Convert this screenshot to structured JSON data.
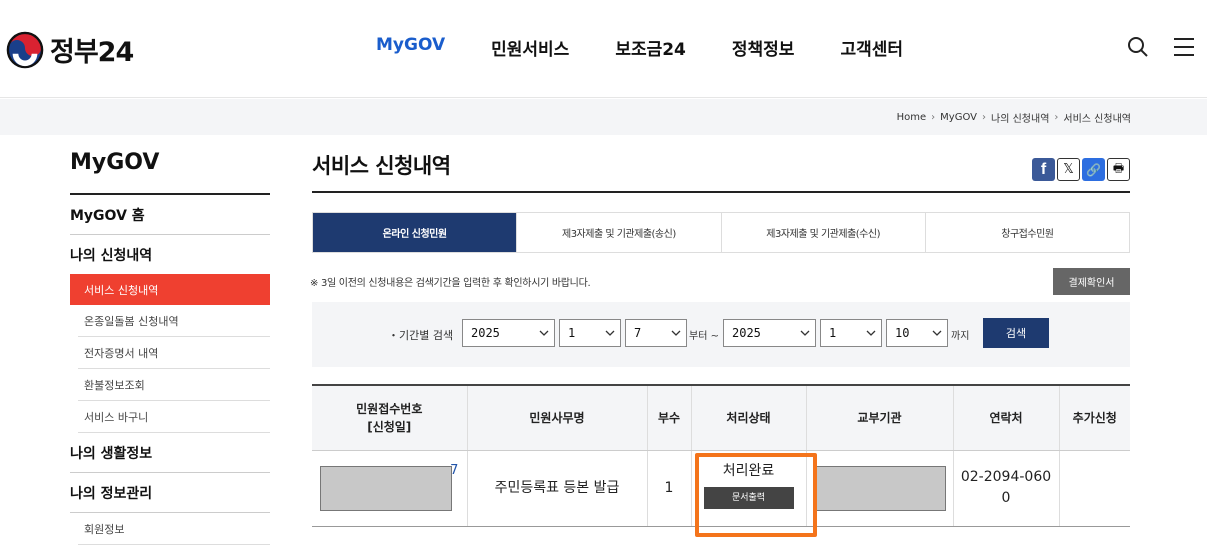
{
  "header": {
    "logo_text": "정부24",
    "nav": [
      "MyGOV",
      "민원서비스",
      "보조금24",
      "정책정보",
      "고객센터"
    ],
    "active_nav": "MyGOV",
    "icons": [
      "search-icon",
      "menu-icon"
    ]
  },
  "breadcrumb": [
    "Home",
    "MyGOV",
    "나의 신청내역",
    "서비스 신청내역"
  ],
  "sidebar": {
    "title": "MyGOV",
    "home": "MyGOV 홈",
    "section1": "나의 신청내역",
    "section1_items": [
      "서비스 신청내역",
      "온종일돌봄 신청내역",
      "전자증명서 내역",
      "환불정보조회",
      "서비스 바구니"
    ],
    "section2": "나의 생활정보",
    "section3": "나의 정보관리",
    "section3_items": [
      "회원정보"
    ]
  },
  "main": {
    "title": "서비스 신청내역",
    "share_icons": [
      "facebook-icon",
      "x-icon",
      "link-icon",
      "print-icon"
    ],
    "tabs": [
      "온라인 신청민원",
      "제3자제출 및 기관제출(송신)",
      "제3자제출 및 기관제출(수신)",
      "창구접수민원"
    ],
    "notice": "※ 3일 이전의 신청내용은 검색기간을 입력한 후 확인하시기 바랍니다.",
    "receipt_button": "결제확인서",
    "search": {
      "label": "・기간별 검색",
      "from_year": "2025",
      "from_month": "1",
      "from_day": "7",
      "from_suffix": "부터 ~",
      "to_year": "2025",
      "to_month": "1",
      "to_day": "10",
      "to_suffix": "까지",
      "button": "검색"
    },
    "table": {
      "headers": [
        "민원접수번호\n[신청일]",
        "민원사무명",
        "부수",
        "처리상태",
        "교부기관",
        "연락처",
        "추가신청"
      ],
      "rows": [
        {
          "receipt_tail": "7",
          "name": "주민등록표 등본 발급",
          "copies": "1",
          "status": "처리완료",
          "status_button": "문서출력",
          "phone": "02-2094-0600",
          "extra": ""
        }
      ]
    }
  },
  "colors": {
    "accent": "#1a5dcc",
    "active_tab": "#1e3a70",
    "sidebar_active": "#ef4030",
    "highlight": "#f4741b"
  }
}
